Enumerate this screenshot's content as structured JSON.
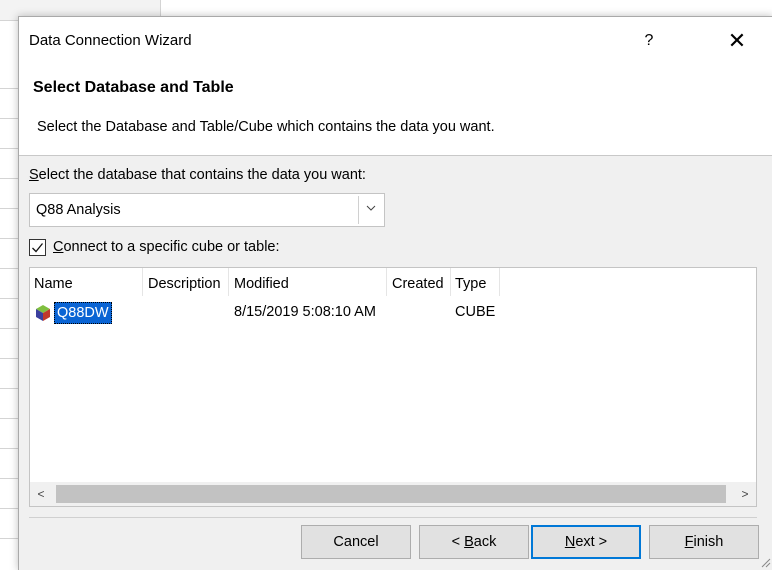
{
  "dialog": {
    "title": "Data Connection Wizard",
    "help_label": "?",
    "close_label": "✕"
  },
  "header": {
    "title": "Select Database and Table",
    "subtitle": "Select the Database and Table/Cube which contains the data you want."
  },
  "database": {
    "label_accel": "S",
    "label_rest": "elect the database that contains the data you want:",
    "selected_value": "Q88 Analysis"
  },
  "connect_checkbox": {
    "checked": true,
    "label_accel": "C",
    "label_rest": "onnect to a specific cube or table:"
  },
  "table": {
    "columns": [
      "Name",
      "Description",
      "Modified",
      "Created",
      "Type"
    ],
    "rows": [
      {
        "name": "Q88DW",
        "description": "",
        "modified": "8/15/2019 5:08:10 AM",
        "created": "",
        "type": "CUBE",
        "icon": "cube-icon",
        "selected": true
      }
    ]
  },
  "scrollbar": {
    "left_arrow": "<",
    "right_arrow": ">"
  },
  "buttons": {
    "cancel": "Cancel",
    "back_prefix": "< ",
    "back_accel": "B",
    "back_rest": "ack",
    "next_accel": "N",
    "next_rest": "ext >",
    "finish_accel": "F",
    "finish_rest": "inish"
  },
  "colors": {
    "selection": "#0a64d4",
    "default_button_border": "#0078d7",
    "dialog_bg": "#f0f0f0"
  }
}
